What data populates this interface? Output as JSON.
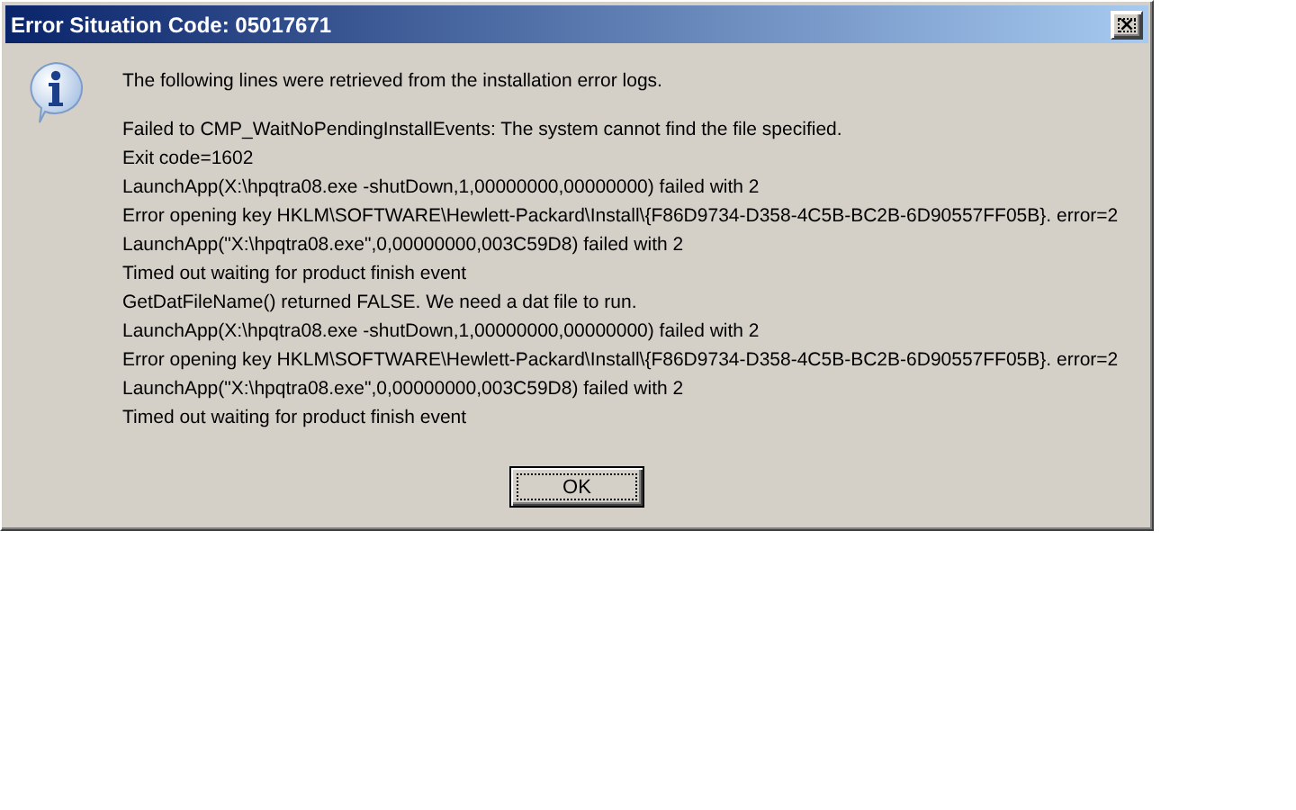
{
  "window": {
    "title": "Error Situation Code: 05017671",
    "close": "×"
  },
  "message": "The following lines were retrieved from the installation error logs.",
  "log_lines": [
    "Failed to CMP_WaitNoPendingInstallEvents: The system cannot find the file specified.",
    "Exit code=1602",
    "LaunchApp(X:\\hpqtra08.exe -shutDown,1,00000000,00000000) failed with 2",
    "Error opening key HKLM\\SOFTWARE\\Hewlett-Packard\\Install\\{F86D9734-D358-4C5B-BC2B-6D90557FF05B}.  error=2",
    "LaunchApp(\"X:\\hpqtra08.exe\",0,00000000,003C59D8) failed with 2",
    "Timed out waiting for product finish event",
    "GetDatFileName() returned FALSE.  We need a dat file to run.",
    "LaunchApp(X:\\hpqtra08.exe -shutDown,1,00000000,00000000) failed with 2",
    "Error opening key HKLM\\SOFTWARE\\Hewlett-Packard\\Install\\{F86D9734-D358-4C5B-BC2B-6D90557FF05B}.  error=2",
    "LaunchApp(\"X:\\hpqtra08.exe\",0,00000000,003C59D8) failed with 2",
    "Timed out waiting for product finish event"
  ],
  "buttons": [
    "OK"
  ]
}
